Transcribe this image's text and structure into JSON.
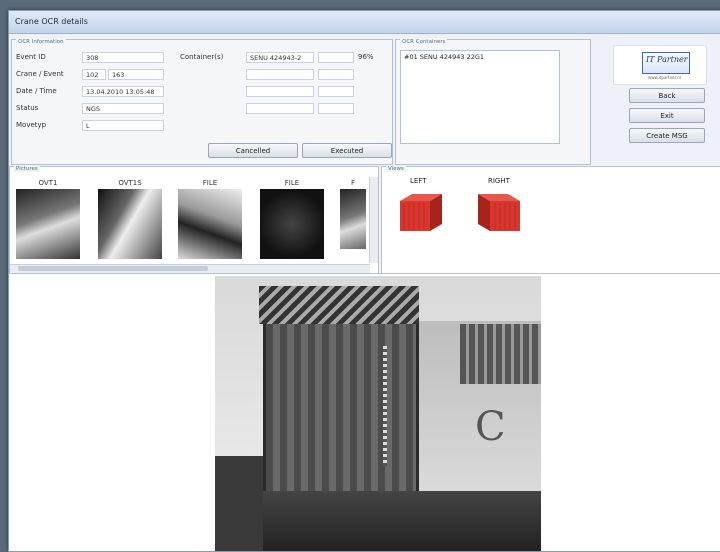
{
  "window": {
    "title": "Crane OCR details"
  },
  "ocr_info": {
    "group_label": "OCR Information",
    "fields": [
      {
        "label": "Event ID",
        "value": "308"
      },
      {
        "label": "Crane / Event",
        "value": "102",
        "value2": "163"
      },
      {
        "label": "Date / Time",
        "value": "13.04.2010 13:05:48"
      },
      {
        "label": "Status",
        "value": "NGS"
      },
      {
        "label": "Movetyp",
        "value": "L"
      }
    ],
    "containers_label": "Container(s)",
    "container_rows": [
      {
        "number": "SENU 424943-2",
        "code": "",
        "percent": "96%"
      },
      {
        "number": "",
        "code": "",
        "percent": ""
      },
      {
        "number": "",
        "code": "",
        "percent": ""
      },
      {
        "number": "",
        "code": "",
        "percent": ""
      }
    ],
    "cancelled_label": "Cancelled",
    "executed_label": "Executed"
  },
  "ocr_containers": {
    "group_label": "OCR Containers",
    "items": [
      "#01 SENU 424943 22G1"
    ]
  },
  "logo": {
    "text": "IT Partner",
    "subtext": "www.itpartner.nl"
  },
  "actions": {
    "back": "Back",
    "exit": "Exit",
    "create_msg": "Create MSG"
  },
  "pictures": {
    "group_label": "Pictures",
    "thumbs": [
      "OVT1",
      "OVT1S",
      "FILE",
      "FILE",
      "F"
    ]
  },
  "views": {
    "group_label": "Views",
    "left": "LEFT",
    "right": "RIGHT"
  },
  "colors": {
    "container_red": "#d8362f",
    "button_border": "#98a6b8"
  }
}
